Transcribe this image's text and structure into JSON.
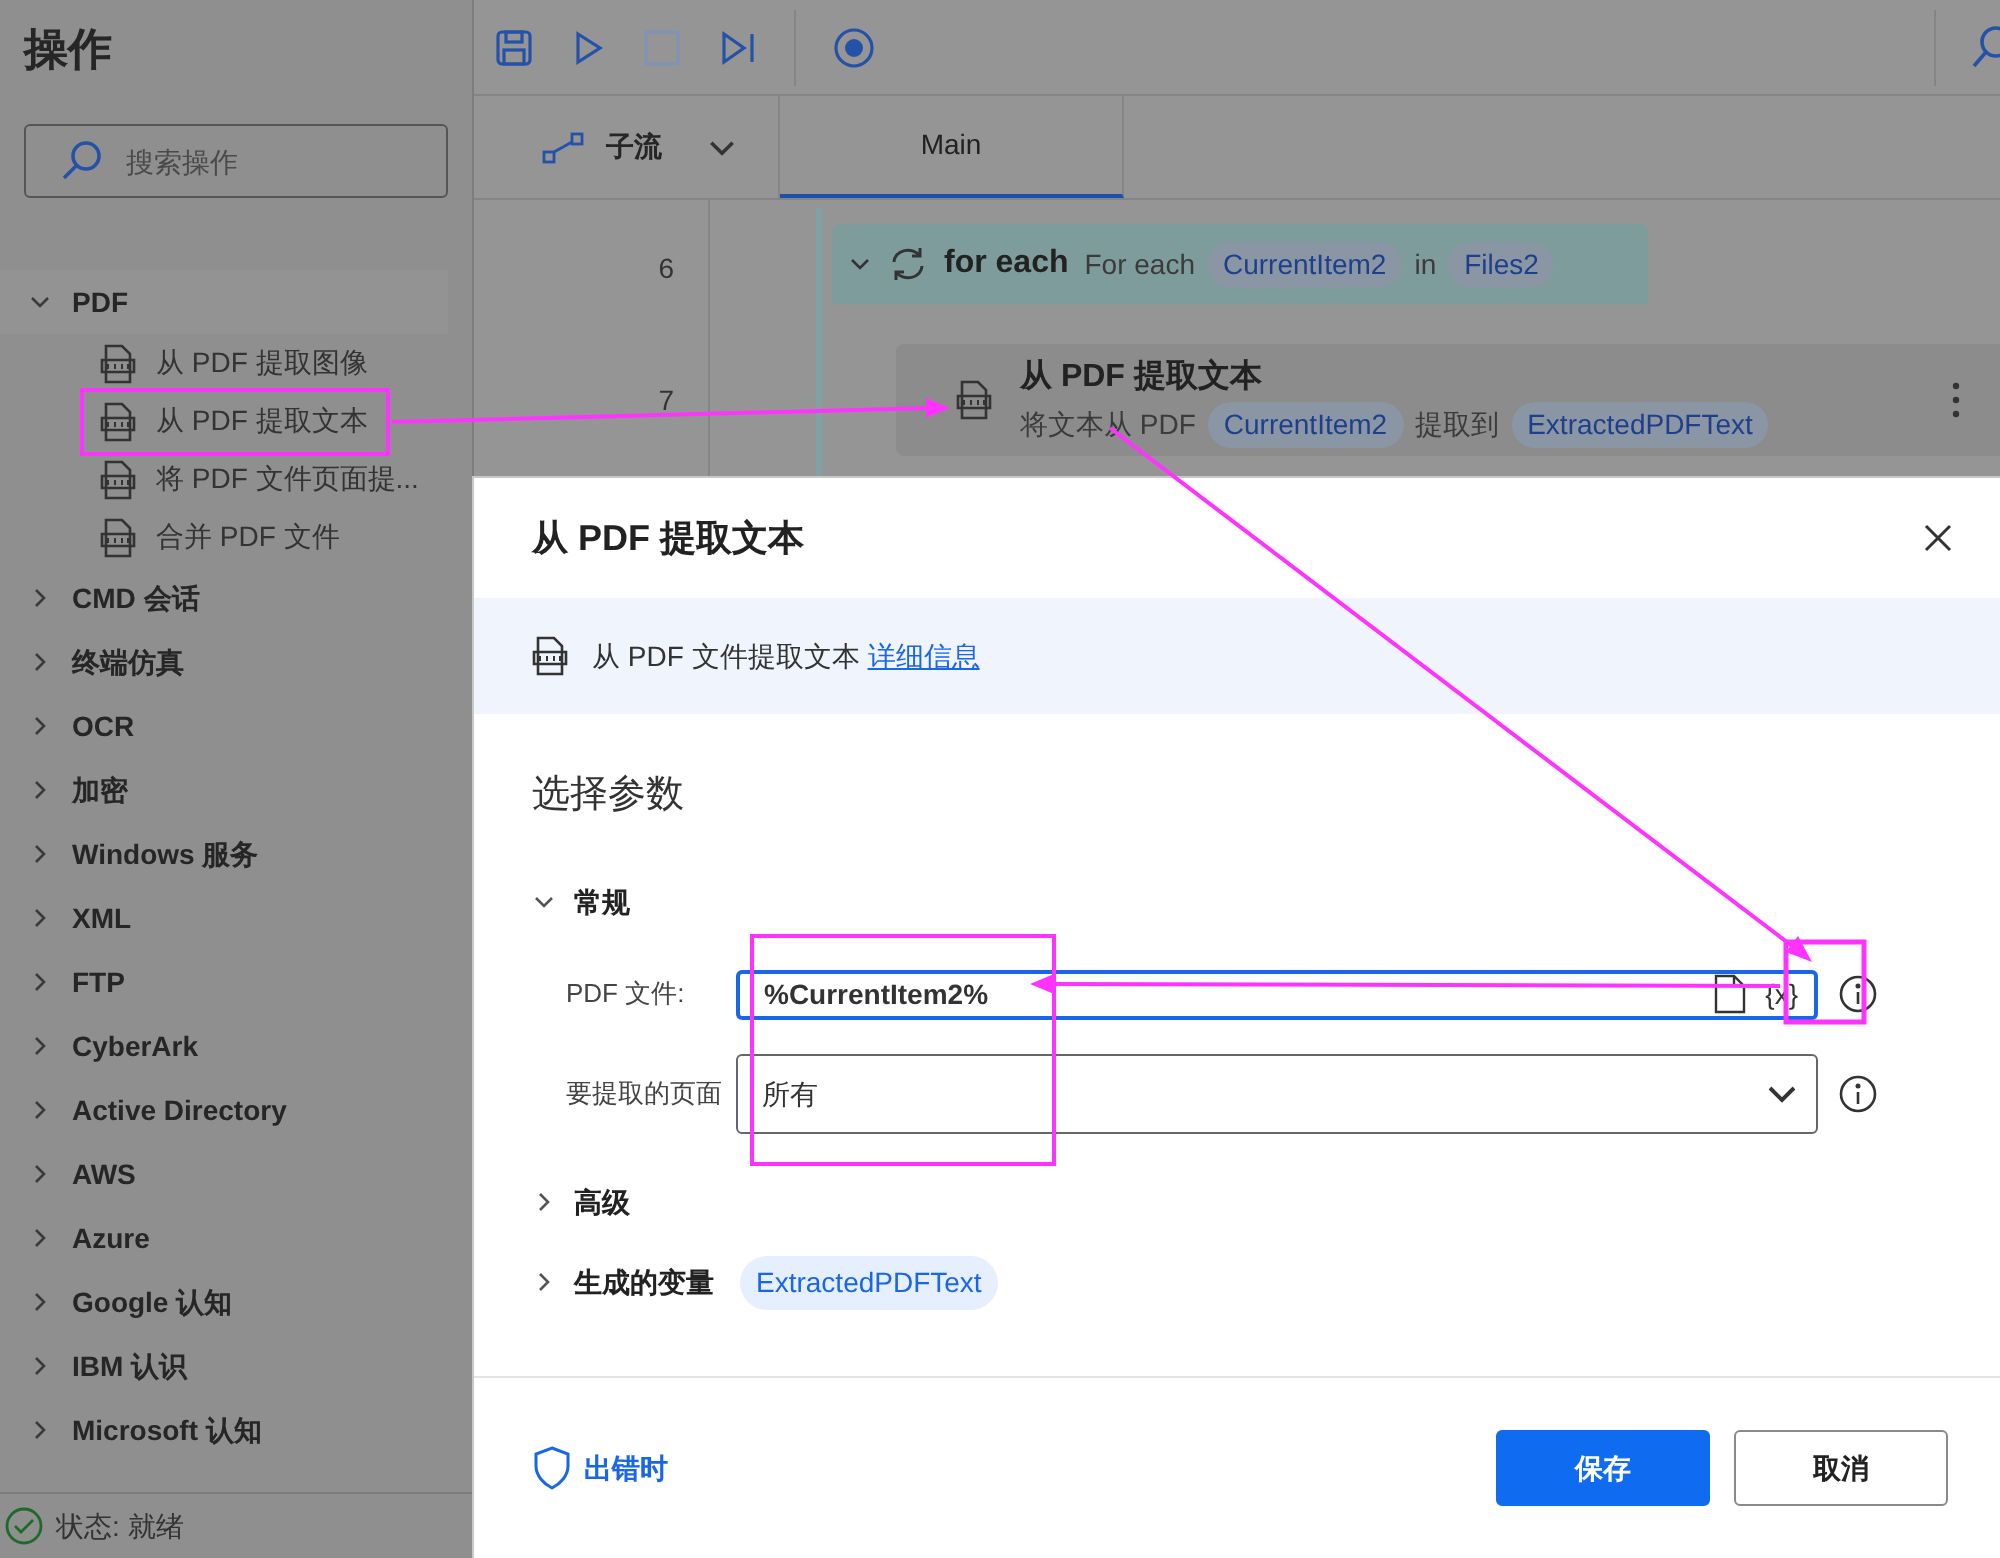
{
  "sidebar": {
    "title": "操作",
    "search": {
      "placeholder": "搜索操作"
    },
    "groups": [
      {
        "label": "PDF",
        "expanded": true,
        "children": [
          {
            "label": "从 PDF 提取图像"
          },
          {
            "label": "从 PDF 提取文本"
          },
          {
            "label": "将 PDF 文件页面提..."
          },
          {
            "label": "合并 PDF 文件"
          }
        ]
      },
      {
        "label": "CMD 会话",
        "expanded": false
      },
      {
        "label": "终端仿真",
        "expanded": false
      },
      {
        "label": "OCR",
        "expanded": false
      },
      {
        "label": "加密",
        "expanded": false
      },
      {
        "label": "Windows 服务",
        "expanded": false
      },
      {
        "label": "XML",
        "expanded": false
      },
      {
        "label": "FTP",
        "expanded": false
      },
      {
        "label": "CyberArk",
        "expanded": false
      },
      {
        "label": "Active Directory",
        "expanded": false
      },
      {
        "label": "AWS",
        "expanded": false
      },
      {
        "label": "Azure",
        "expanded": false
      },
      {
        "label": "Google 认知",
        "expanded": false
      },
      {
        "label": "IBM 认识",
        "expanded": false
      },
      {
        "label": "Microsoft 认知",
        "expanded": false
      }
    ]
  },
  "status_bar": {
    "text": "状态: 就绪"
  },
  "tabs": [
    {
      "label": "子流",
      "kind": "dropdown",
      "selected": false
    },
    {
      "label": "Main",
      "kind": "plain",
      "selected": true
    }
  ],
  "flow": {
    "rows": [
      {
        "line": "6",
        "kind": "loop",
        "expanded": true,
        "title": "for each",
        "parts": [
          {
            "kind": "text",
            "text": "For each"
          },
          {
            "kind": "token",
            "text": "CurrentItem2"
          },
          {
            "kind": "text",
            "text": "in"
          },
          {
            "kind": "token",
            "text": "Files2"
          }
        ]
      },
      {
        "line": "7",
        "kind": "action",
        "title": "从 PDF 提取文本",
        "parts": [
          {
            "kind": "text",
            "text": "将文本从 PDF"
          },
          {
            "kind": "token",
            "text": "CurrentItem2"
          },
          {
            "kind": "text",
            "text": "提取到"
          },
          {
            "kind": "token",
            "text": "ExtractedPDFText"
          }
        ]
      }
    ]
  },
  "dialog": {
    "title": "从 PDF 提取文本",
    "info": {
      "text": "从 PDF 文件提取文本",
      "link": "详细信息"
    },
    "section": "选择参数",
    "groups": [
      {
        "label": "常规",
        "expanded": true,
        "fields": [
          {
            "label": "PDF 文件:",
            "kind": "text",
            "value": "%CurrentItem2%",
            "variable_button": "{x}",
            "focused": true
          },
          {
            "label": "要提取的页面",
            "kind": "select",
            "value": "所有",
            "focused": false
          }
        ]
      },
      {
        "label": "高级",
        "expanded": false
      },
      {
        "label": "生成的变量",
        "expanded": false,
        "token": "ExtractedPDFText"
      }
    ],
    "error_link": "出错时",
    "buttons": [
      {
        "label": "保存",
        "kind": "primary"
      },
      {
        "label": "取消",
        "kind": "secondary"
      }
    ]
  }
}
